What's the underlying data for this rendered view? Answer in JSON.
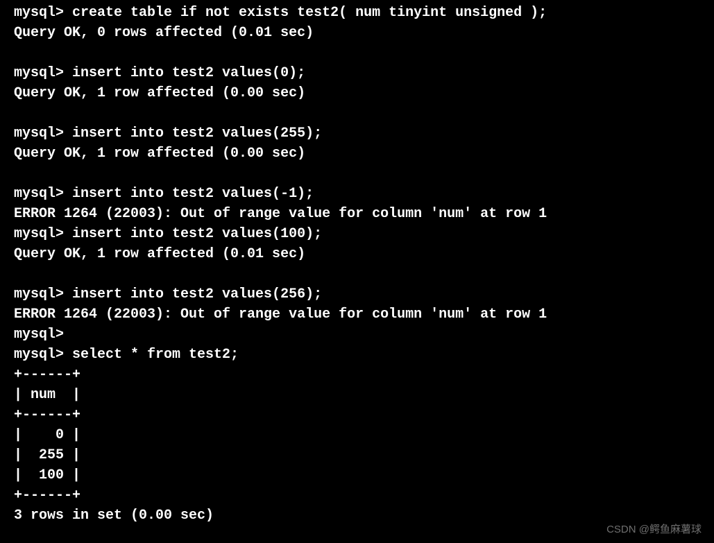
{
  "lines": [
    {
      "text": "mysql> create table if not exists test2( num tinyint unsigned );"
    },
    {
      "text": "Query OK, 0 rows affected (0.01 sec)"
    },
    {
      "text": ""
    },
    {
      "text": "mysql> insert into test2 values(0);"
    },
    {
      "text": "Query OK, 1 row affected (0.00 sec)"
    },
    {
      "text": ""
    },
    {
      "text": "mysql> insert into test2 values(255);"
    },
    {
      "text": "Query OK, 1 row affected (0.00 sec)"
    },
    {
      "text": ""
    },
    {
      "text": "mysql> insert into test2 values(-1);"
    },
    {
      "text": "ERROR 1264 (22003): Out of range value for column 'num' at row 1"
    },
    {
      "text": "mysql> insert into test2 values(100);"
    },
    {
      "text": "Query OK, 1 row affected (0.01 sec)"
    },
    {
      "text": ""
    },
    {
      "text": "mysql> insert into test2 values(256);"
    },
    {
      "text": "ERROR 1264 (22003): Out of range value for column 'num' at row 1"
    },
    {
      "text": "mysql> "
    },
    {
      "text": "mysql> select * from test2;"
    },
    {
      "text": "+------+"
    },
    {
      "text": "| num  |"
    },
    {
      "text": "+------+"
    },
    {
      "text": "|    0 |"
    },
    {
      "text": "|  255 |"
    },
    {
      "text": "|  100 |"
    },
    {
      "text": "+------+"
    },
    {
      "text": "3 rows in set (0.00 sec)"
    }
  ],
  "watermark": "CSDN @鳄鱼麻薯球"
}
